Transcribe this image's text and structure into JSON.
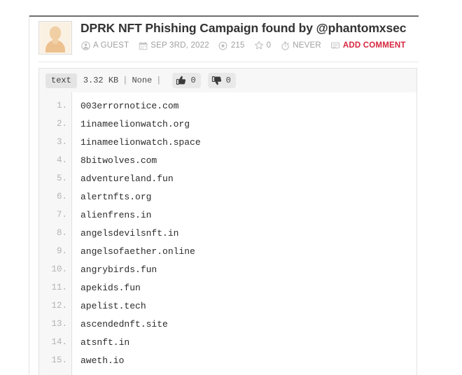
{
  "paste": {
    "title": "DPRK NFT Phishing Campaign found by @phantomxsec",
    "avatar_icon": "guest-avatar-icon",
    "meta": {
      "author": "A GUEST",
      "author_icon": "user-circle-icon",
      "date": "SEP 3RD, 2022",
      "date_icon": "calendar-icon",
      "views": "215",
      "views_icon": "eye-icon",
      "favorites": "0",
      "favorites_icon": "star-icon",
      "expires": "NEVER",
      "expires_icon": "stopwatch-icon",
      "add_comment": "ADD COMMENT",
      "add_comment_icon": "comment-icon"
    }
  },
  "toolbar": {
    "format": "text",
    "size": "3.32 KB",
    "separator": "|",
    "category": "None",
    "like_count": "0",
    "like_icon": "thumbs-up-icon",
    "dislike_count": "0",
    "dislike_icon": "thumbs-down-icon"
  },
  "code": {
    "lines": [
      {
        "n": "1.",
        "text": "003errornotice.com"
      },
      {
        "n": "2.",
        "text": "1inameelionwatch.org"
      },
      {
        "n": "3.",
        "text": "1inameelionwatch.space"
      },
      {
        "n": "4.",
        "text": "8bitwolves.com"
      },
      {
        "n": "5.",
        "text": "adventureland.fun"
      },
      {
        "n": "6.",
        "text": "alertnfts.org"
      },
      {
        "n": "7.",
        "text": "alienfrens.in"
      },
      {
        "n": "8.",
        "text": "angelsdevilsnft.in"
      },
      {
        "n": "9.",
        "text": "angelsofaether.online"
      },
      {
        "n": "10.",
        "text": "angrybirds.fun"
      },
      {
        "n": "11.",
        "text": "apekids.fun"
      },
      {
        "n": "12.",
        "text": "apelist.tech"
      },
      {
        "n": "13.",
        "text": "ascendednft.site"
      },
      {
        "n": "14.",
        "text": "atsnft.in"
      },
      {
        "n": "15.",
        "text": "aweth.io"
      }
    ]
  },
  "colors": {
    "accent_red": "#d6273f",
    "title_gray": "#333333",
    "meta_gray": "#a0a0a0",
    "toolbar_bg": "#f7f7f7",
    "gutter_bg": "#f7f7f7",
    "border": "#e2e2e2"
  }
}
